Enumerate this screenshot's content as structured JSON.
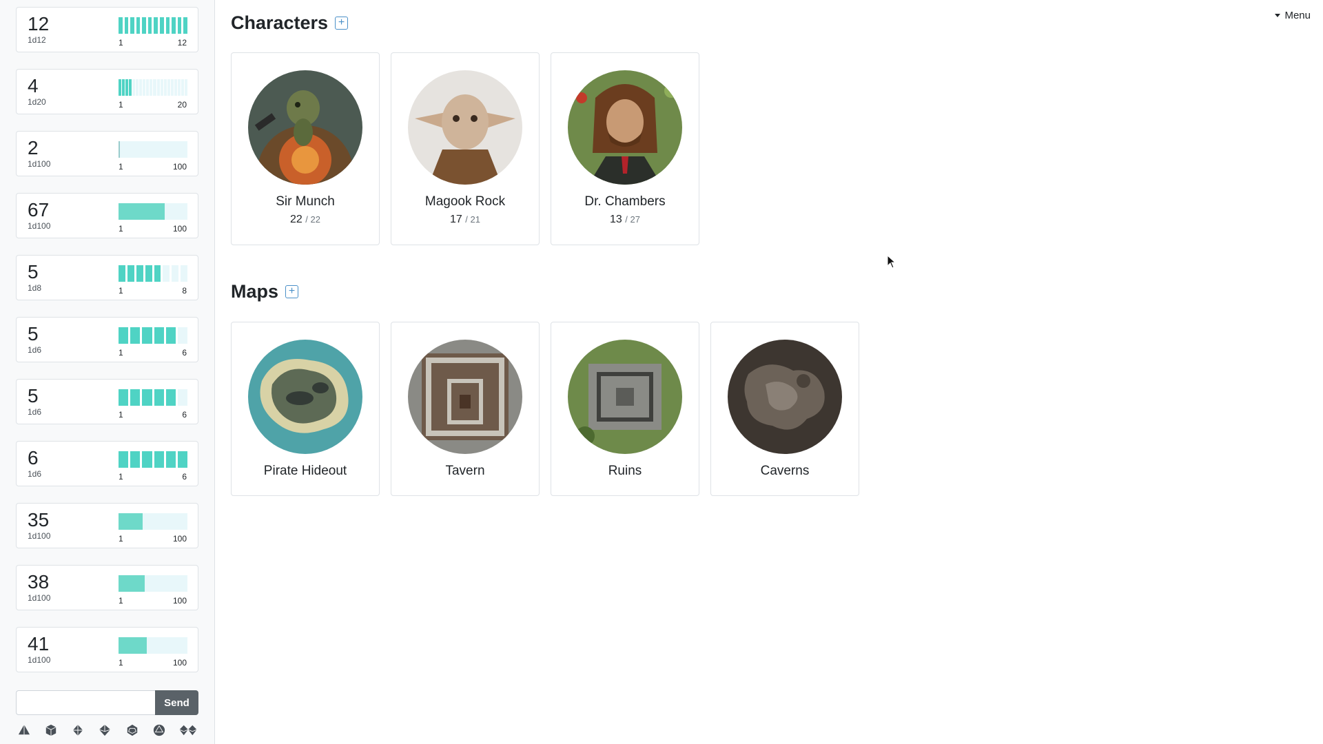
{
  "rolls": [
    {
      "total": "12",
      "formula": "1d12",
      "min": "1",
      "max": "12",
      "result": 12,
      "sides": 12
    },
    {
      "total": "4",
      "formula": "1d20",
      "min": "1",
      "max": "20",
      "result": 4,
      "sides": 20
    },
    {
      "total": "2",
      "formula": "1d100",
      "min": "1",
      "max": "100",
      "result": 2,
      "sides": 100
    },
    {
      "total": "67",
      "formula": "1d100",
      "min": "1",
      "max": "100",
      "result": 67,
      "sides": 100
    },
    {
      "total": "5",
      "formula": "1d8",
      "min": "1",
      "max": "8",
      "result": 5,
      "sides": 8
    },
    {
      "total": "5",
      "formula": "1d6",
      "min": "1",
      "max": "6",
      "result": 5,
      "sides": 6
    },
    {
      "total": "5",
      "formula": "1d6",
      "min": "1",
      "max": "6",
      "result": 5,
      "sides": 6
    },
    {
      "total": "6",
      "formula": "1d6",
      "min": "1",
      "max": "6",
      "result": 6,
      "sides": 6
    },
    {
      "total": "35",
      "formula": "1d100",
      "min": "1",
      "max": "100",
      "result": 35,
      "sides": 100
    },
    {
      "total": "38",
      "formula": "1d100",
      "min": "1",
      "max": "100",
      "result": 38,
      "sides": 100
    },
    {
      "total": "41",
      "formula": "1d100",
      "min": "1",
      "max": "100",
      "result": 41,
      "sides": 100
    }
  ],
  "chat": {
    "placeholder": "",
    "send_label": "Send"
  },
  "dice_buttons": [
    "d4-icon",
    "d6-icon",
    "d8-icon",
    "d10-icon",
    "d12-icon",
    "d20-icon",
    "d100-icon"
  ],
  "menu": {
    "label": "Menu"
  },
  "characters": {
    "title": "Characters",
    "items": [
      {
        "name": "Sir Munch",
        "hp": "22",
        "hp_max": "/ 22",
        "icon": "turtle-knight-portrait"
      },
      {
        "name": "Magook Rock",
        "hp": "17",
        "hp_max": "/ 21",
        "icon": "goblin-portrait"
      },
      {
        "name": "Dr. Chambers",
        "hp": "13",
        "hp_max": "/ 27",
        "icon": "bard-portrait"
      }
    ]
  },
  "maps": {
    "title": "Maps",
    "items": [
      {
        "name": "Pirate Hideout",
        "icon": "island-map"
      },
      {
        "name": "Tavern",
        "icon": "tavern-map"
      },
      {
        "name": "Ruins",
        "icon": "ruins-map"
      },
      {
        "name": "Caverns",
        "icon": "caverns-map"
      }
    ]
  },
  "colors": {
    "accent": "#4fd3c4",
    "bar_bg": "#e8f7fa",
    "link": "#4a90c8",
    "button": "#5a6268"
  }
}
